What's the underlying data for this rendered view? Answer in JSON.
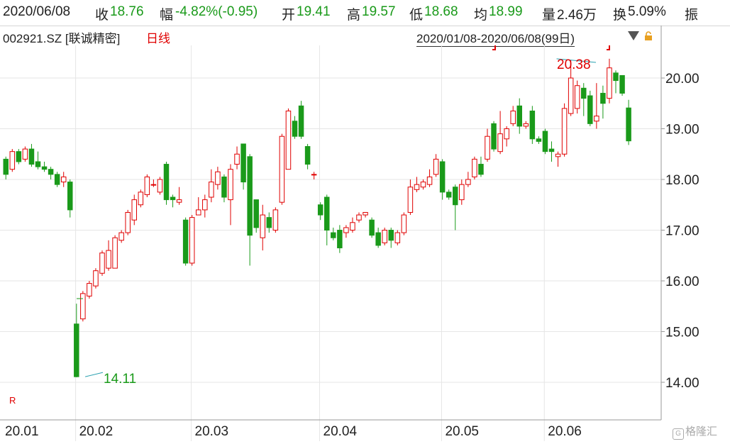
{
  "header": {
    "date": "2020/06/08",
    "close_label": "收",
    "close": "18.76",
    "change_label": "幅",
    "change": "-4.82%(-0.95)",
    "open_label": "开",
    "open": "19.41",
    "high_label": "高",
    "high": "19.57",
    "low_label": "低",
    "low": "18.68",
    "avg_label": "均",
    "avg": "18.99",
    "volume_label": "量",
    "volume": "2.46万",
    "turnover_label": "换",
    "turnover": "5.09%",
    "amplitude_label": "振"
  },
  "subheader": {
    "stock": "002921.SZ [联诚精密]",
    "period": "日线",
    "range": "2020/01/08-2020/06/08(99日)"
  },
  "colors": {
    "up": "#e00000",
    "down": "#1a9a1a",
    "grid": "#e6e6e6"
  },
  "chart_data": {
    "type": "candlestick",
    "ylim": [
      13.5,
      20.6
    ],
    "y_ticks": [
      "14.00",
      "15.00",
      "16.00",
      "17.00",
      "18.00",
      "19.00",
      "20.00"
    ],
    "x_labels": [
      {
        "label": "20.01",
        "index": 0
      },
      {
        "label": "20.02",
        "index": 12
      },
      {
        "label": "20.03",
        "index": 30
      },
      {
        "label": "20.04",
        "index": 50
      },
      {
        "label": "20.05",
        "index": 69
      },
      {
        "label": "20.06",
        "index": 85
      }
    ],
    "annotations": [
      {
        "label": "20.38",
        "index": 86,
        "value": 20.38
      },
      {
        "label": "14.11",
        "index": 12,
        "value": 14.11
      }
    ],
    "marker": "R",
    "candles": [
      [
        18.4,
        18.1,
        18.45,
        18.0
      ],
      [
        18.2,
        18.55,
        18.6,
        18.15
      ],
      [
        18.55,
        18.35,
        18.6,
        18.3
      ],
      [
        18.4,
        18.6,
        18.65,
        18.35
      ],
      [
        18.6,
        18.3,
        18.7,
        18.25
      ],
      [
        18.35,
        18.25,
        18.55,
        18.2
      ],
      [
        18.25,
        18.2,
        18.35,
        18.15
      ],
      [
        18.2,
        18.1,
        18.25,
        18.0
      ],
      [
        18.1,
        17.9,
        18.15,
        17.85
      ],
      [
        17.95,
        18.05,
        18.15,
        17.85
      ],
      [
        17.95,
        17.4,
        18.0,
        17.25
      ],
      [
        15.15,
        14.11,
        15.55,
        14.1
      ],
      [
        15.25,
        15.75,
        15.8,
        15.2
      ],
      [
        15.7,
        15.95,
        16.0,
        15.65
      ],
      [
        15.9,
        16.2,
        16.25,
        15.85
      ],
      [
        16.15,
        16.55,
        16.6,
        16.1
      ],
      [
        16.25,
        16.6,
        16.8,
        16.2
      ],
      [
        16.25,
        16.85,
        16.9,
        16.25
      ],
      [
        16.8,
        16.95,
        17.0,
        16.75
      ],
      [
        16.95,
        17.35,
        17.4,
        16.9
      ],
      [
        17.2,
        17.6,
        17.7,
        17.1
      ],
      [
        17.5,
        17.75,
        17.8,
        17.45
      ],
      [
        17.7,
        18.05,
        18.1,
        17.65
      ],
      [
        17.9,
        17.9,
        18.0,
        17.85
      ],
      [
        17.75,
        18.0,
        18.05,
        17.7
      ],
      [
        18.3,
        17.6,
        18.35,
        17.5
      ],
      [
        17.65,
        17.6,
        17.7,
        17.45
      ],
      [
        17.55,
        17.6,
        17.85,
        17.5
      ],
      [
        17.2,
        16.35,
        17.25,
        16.3
      ],
      [
        16.35,
        17.25,
        17.3,
        16.3
      ],
      [
        17.3,
        17.4,
        17.65,
        17.3
      ],
      [
        17.4,
        17.6,
        17.7,
        17.25
      ],
      [
        17.65,
        17.95,
        18.2,
        17.55
      ],
      [
        17.9,
        18.15,
        18.25,
        17.8
      ],
      [
        18.05,
        17.65,
        18.1,
        17.55
      ],
      [
        17.6,
        18.2,
        18.3,
        17.1
      ],
      [
        18.3,
        18.5,
        18.65,
        18.2
      ],
      [
        18.7,
        17.95,
        18.7,
        17.8
      ],
      [
        18.45,
        16.9,
        18.5,
        16.3
      ],
      [
        17.6,
        17.05,
        17.6,
        16.95
      ],
      [
        16.85,
        17.3,
        17.5,
        16.6
      ],
      [
        17.25,
        17.05,
        17.35,
        16.95
      ],
      [
        17.0,
        17.4,
        17.45,
        16.95
      ],
      [
        17.55,
        18.85,
        18.9,
        17.5
      ],
      [
        18.2,
        19.35,
        19.4,
        18.2
      ],
      [
        19.15,
        18.85,
        19.25,
        18.8
      ],
      [
        19.45,
        18.85,
        19.55,
        18.8
      ],
      [
        18.65,
        18.3,
        18.7,
        18.2
      ],
      [
        18.1,
        18.1,
        18.15,
        18.0
      ],
      [
        17.5,
        17.3,
        17.55,
        17.2
      ],
      [
        17.65,
        17.0,
        17.7,
        16.7
      ],
      [
        16.95,
        16.85,
        17.05,
        16.8
      ],
      [
        17.0,
        16.65,
        17.1,
        16.55
      ],
      [
        16.95,
        17.05,
        17.1,
        16.85
      ],
      [
        17.0,
        17.15,
        17.25,
        16.95
      ],
      [
        17.2,
        17.3,
        17.35,
        17.15
      ],
      [
        17.3,
        17.35,
        17.35,
        17.25
      ],
      [
        17.2,
        16.9,
        17.25,
        16.85
      ],
      [
        16.95,
        16.7,
        17.05,
        16.65
      ],
      [
        16.75,
        17.0,
        17.05,
        16.7
      ],
      [
        17.0,
        16.8,
        17.05,
        16.65
      ],
      [
        16.75,
        16.95,
        17.0,
        16.7
      ],
      [
        16.95,
        17.3,
        17.35,
        16.9
      ],
      [
        17.35,
        17.85,
        18.0,
        17.3
      ],
      [
        17.8,
        17.9,
        18.05,
        17.75
      ],
      [
        17.85,
        17.95,
        18.0,
        17.8
      ],
      [
        17.9,
        18.05,
        18.2,
        17.85
      ],
      [
        18.1,
        18.4,
        18.5,
        18.05
      ],
      [
        18.35,
        17.75,
        18.4,
        17.6
      ],
      [
        17.75,
        17.65,
        17.8,
        17.6
      ],
      [
        17.85,
        17.5,
        17.9,
        17.0
      ],
      [
        17.6,
        17.9,
        18.0,
        17.5
      ],
      [
        17.9,
        18.0,
        18.15,
        17.85
      ],
      [
        18.05,
        18.4,
        18.45,
        18.0
      ],
      [
        18.3,
        18.1,
        18.45,
        18.05
      ],
      [
        18.4,
        18.85,
        19.0,
        18.35
      ],
      [
        19.1,
        18.6,
        19.15,
        18.55
      ],
      [
        18.55,
        18.9,
        19.35,
        18.5
      ],
      [
        18.8,
        19.0,
        19.05,
        18.65
      ],
      [
        19.1,
        19.35,
        19.45,
        19.05
      ],
      [
        19.45,
        19.05,
        19.6,
        18.9
      ],
      [
        19.05,
        19.1,
        19.15,
        19.0
      ],
      [
        19.35,
        18.8,
        19.45,
        18.7
      ],
      [
        18.8,
        18.75,
        18.85,
        18.7
      ],
      [
        18.95,
        18.55,
        19.0,
        18.5
      ],
      [
        18.6,
        18.55,
        18.75,
        18.35
      ],
      [
        18.45,
        18.5,
        18.55,
        18.25
      ],
      [
        18.5,
        19.4,
        19.5,
        18.45
      ],
      [
        19.3,
        20.0,
        20.35,
        19.25
      ],
      [
        19.4,
        19.85,
        19.95,
        19.3
      ],
      [
        19.8,
        19.6,
        19.9,
        19.25
      ],
      [
        19.65,
        19.1,
        19.75,
        19.05
      ],
      [
        19.15,
        19.25,
        19.9,
        19.0
      ],
      [
        19.7,
        19.5,
        19.85,
        19.2
      ],
      [
        19.6,
        20.2,
        20.38,
        19.5
      ],
      [
        20.1,
        19.95,
        20.15,
        19.7
      ],
      [
        20.05,
        19.7,
        20.05,
        19.65
      ],
      [
        19.41,
        18.76,
        19.57,
        18.68
      ]
    ]
  }
}
